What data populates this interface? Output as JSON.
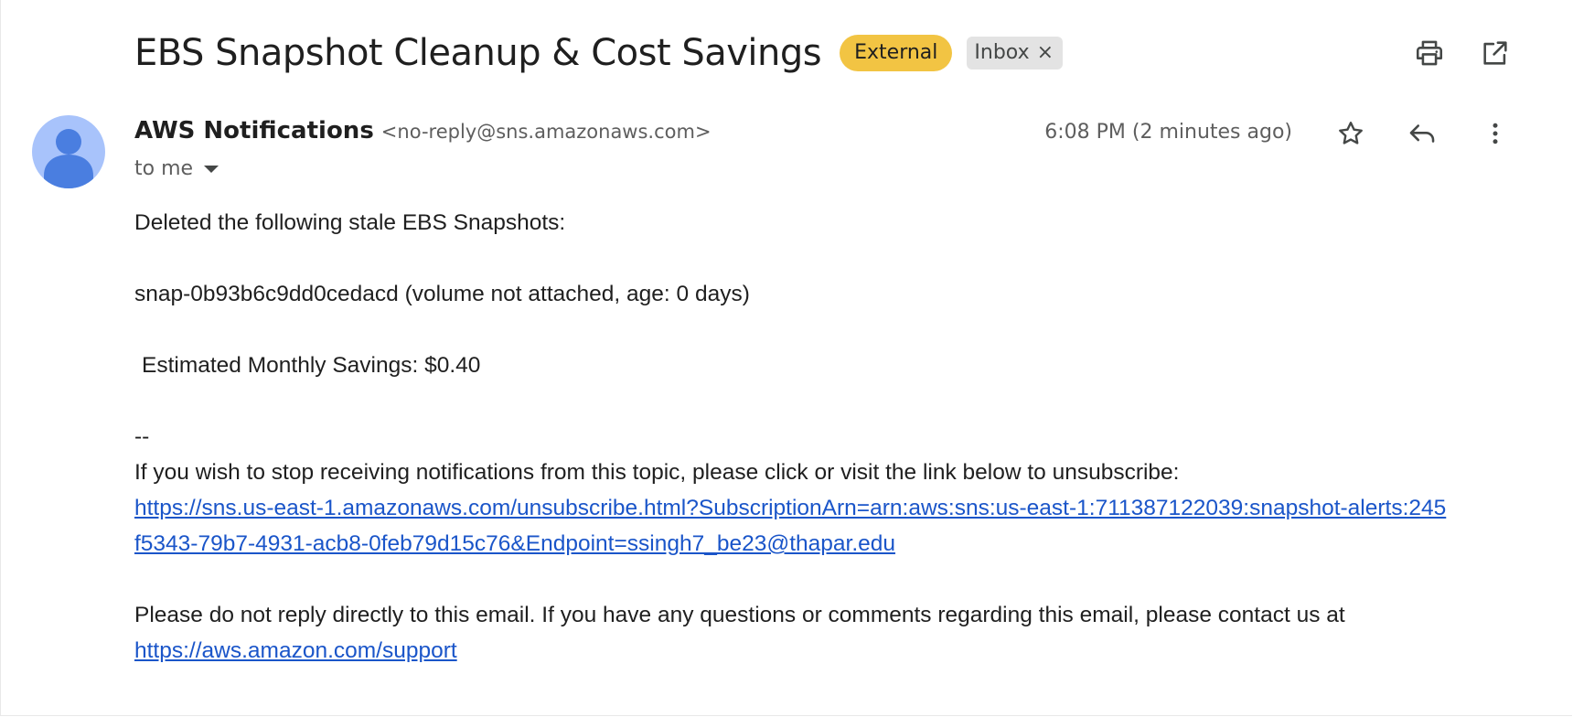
{
  "header": {
    "subject": "EBS Snapshot Cleanup & Cost Savings",
    "badge_external": "External",
    "badge_inbox": "Inbox",
    "badge_inbox_remove": "×"
  },
  "sender": {
    "name": "AWS Notifications",
    "email": "<no-reply@sns.amazonaws.com>",
    "recipient": "to me",
    "timestamp": "6:08 PM (2 minutes ago)"
  },
  "body": {
    "intro": "Deleted the following stale EBS Snapshots:",
    "snapshot": "snap-0b93b6c9dd0cedacd (volume not attached, age: 0 days)",
    "savings": "Estimated Monthly Savings: $0.40",
    "separator": "--",
    "unsubscribe_text": "If you wish to stop receiving notifications from this topic, please click or visit the link below to unsubscribe:",
    "unsubscribe_link": "https://sns.us-east-1.amazonaws.com/unsubscribe.html?SubscriptionArn=arn:aws:sns:us-east-1:711387122039:snapshot-alerts:245f5343-79b7-4931-acb8-0feb79d15c76&Endpoint=ssingh7_be23@thapar.edu",
    "support_text": "Please do not reply directly to this email. If you have any questions or comments regarding this email, please contact us at",
    "support_link": "https://aws.amazon.com/support"
  },
  "icons": {
    "print": "print-icon",
    "open_new_window": "open-in-new-window-icon",
    "star": "star-icon",
    "reply": "reply-icon",
    "more": "more-vertical-icon",
    "avatar": "default-avatar-icon",
    "caret": "chevron-down-icon"
  },
  "colors": {
    "external_badge": "#f2c443",
    "inbox_badge": "#e3e3e3",
    "link": "#1a55c9",
    "avatar_bg": "#a8c3fb",
    "avatar_fg": "#4a7ee0"
  }
}
